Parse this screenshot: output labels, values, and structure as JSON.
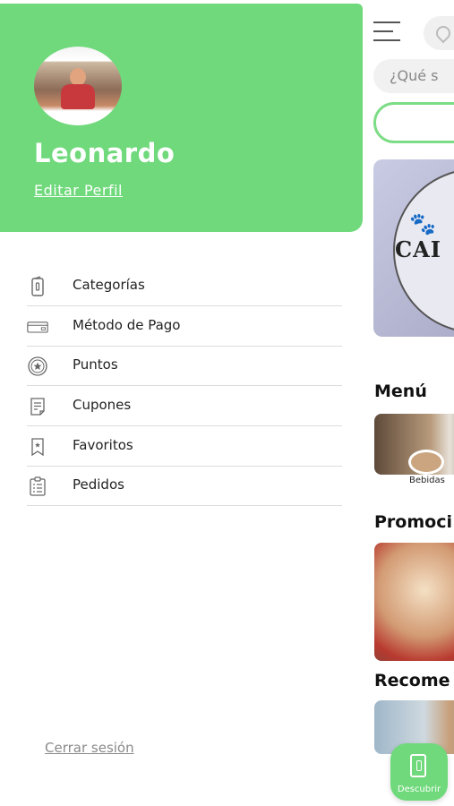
{
  "drawer": {
    "user_name": "Leonardo",
    "edit_profile": "Editar Perfil",
    "menu": [
      {
        "label": "Categorías",
        "icon": "menu-card-icon"
      },
      {
        "label": "Método de Pago",
        "icon": "credit-card-icon"
      },
      {
        "label": "Puntos",
        "icon": "star-badge-icon"
      },
      {
        "label": "Cupones",
        "icon": "coupon-icon"
      },
      {
        "label": "Favoritos",
        "icon": "bookmark-icon"
      },
      {
        "label": "Pedidos",
        "icon": "clipboard-icon"
      }
    ],
    "logout": "Cerrar sesión"
  },
  "app": {
    "search_placeholder": "¿Qué s",
    "banner_text": "CAI",
    "sections": {
      "menu_title": "Menú",
      "menu_item_label": "Bebidas",
      "promo_title": "Promoci",
      "recommended_title": "Recome"
    },
    "fab_label": "Descubrir"
  },
  "colors": {
    "accent": "#6fd97b",
    "divider": "#dcdcdc"
  }
}
